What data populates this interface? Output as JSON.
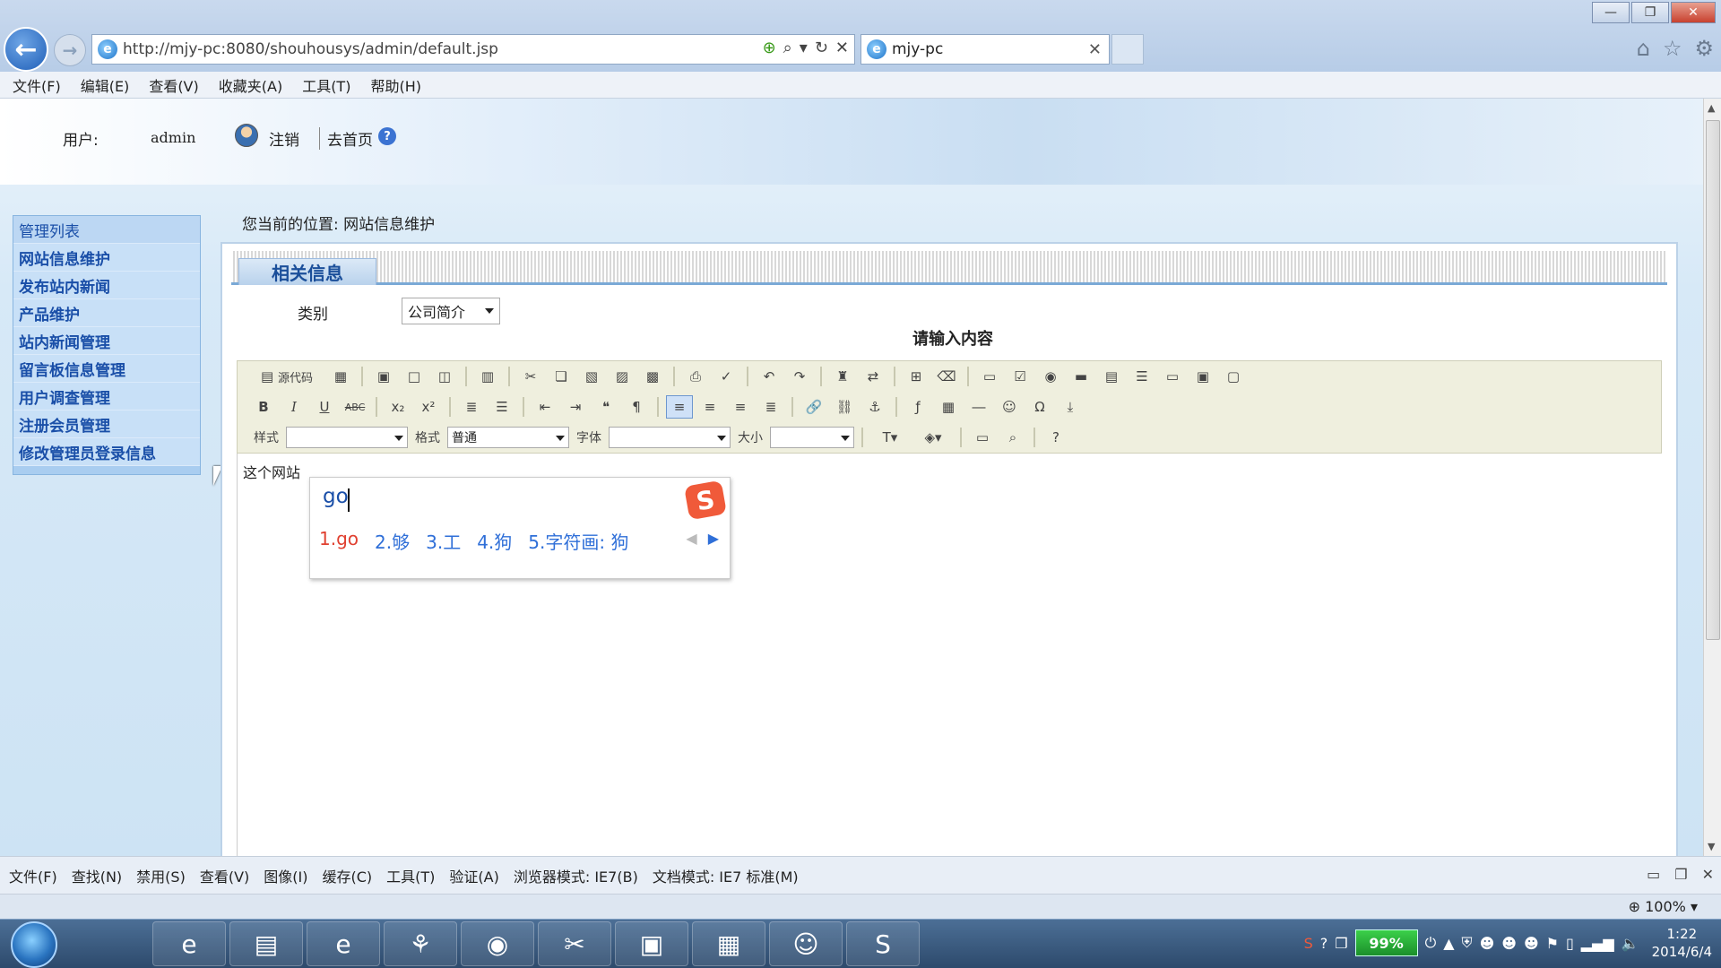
{
  "browser": {
    "url": "http://mjy-pc:8080/shouhousys/admin/default.jsp",
    "tab_title": "mjy-pc",
    "menu": [
      "文件(F)",
      "编辑(E)",
      "查看(V)",
      "收藏夹(A)",
      "工具(T)",
      "帮助(H)"
    ]
  },
  "header": {
    "user_label": "用户:",
    "username": "admin",
    "logout": "注销",
    "home": "去首页"
  },
  "sidebar": {
    "title": "管理列表",
    "items": [
      "网站信息维护",
      "发布站内新闻",
      "产品维护",
      "站内新闻管理",
      "留言板信息管理",
      "用户调查管理",
      "注册会员管理",
      "修改管理员登录信息"
    ]
  },
  "main": {
    "breadcrumb": "您当前的位置: 网站信息维护",
    "panel_tab": "相关信息",
    "category_label": "类别",
    "category_value": "公司简介",
    "editor_title": "请输入内容",
    "toolbar": {
      "source": "源代码",
      "style_label": "样式",
      "format_label": "格式",
      "format_value": "普通",
      "font_label": "字体",
      "size_label": "大小"
    },
    "content_text": "这个网站"
  },
  "ime": {
    "input": "go",
    "candidates": [
      "1.go",
      "2.够",
      "3.工",
      "4.狗",
      "5.字符画: 狗"
    ]
  },
  "devtools": {
    "menu": [
      "文件(F)",
      "查找(N)",
      "禁用(S)",
      "查看(V)",
      "图像(I)",
      "缓存(C)",
      "工具(T)",
      "验证(A)"
    ],
    "browser_mode": "浏览器模式: IE7(B)",
    "doc_mode": "文档模式: IE7 标准(M)"
  },
  "status": {
    "zoom": "100%"
  },
  "taskbar": {
    "battery": "99%",
    "time": "1:22",
    "date": "2014/6/4"
  }
}
